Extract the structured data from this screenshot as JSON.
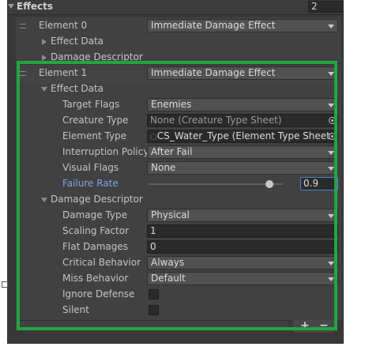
{
  "header": {
    "title": "Effects",
    "count": "2"
  },
  "element0": {
    "label": "Element 0",
    "type": "Immediate Damage Effect",
    "children": [
      "Effect Data",
      "Damage Descriptor"
    ]
  },
  "element1": {
    "label": "Element 1",
    "type": "Immediate Damage Effect",
    "effect_data": {
      "label": "Effect Data",
      "target_flags": {
        "label": "Target Flags",
        "value": "Enemies"
      },
      "creature_type": {
        "label": "Creature Type",
        "value": "None (Creature Type Sheet)"
      },
      "element_type": {
        "label": "Element Type",
        "value": "CS_Water_Type (Element Type Sheet"
      },
      "interruption_policy": {
        "label": "Interruption Policy",
        "value": "After Fail"
      },
      "visual_flags": {
        "label": "Visual Flags",
        "value": "None"
      },
      "failure_rate": {
        "label": "Failure Rate",
        "value": "0.9",
        "fraction": 0.9
      }
    },
    "damage_descriptor": {
      "label": "Damage Descriptor",
      "damage_type": {
        "label": "Damage Type",
        "value": "Physical"
      },
      "scaling_factor": {
        "label": "Scaling Factor",
        "value": "1"
      },
      "flat_damages": {
        "label": "Flat Damages",
        "value": "0"
      },
      "critical_behavior": {
        "label": "Critical Behavior",
        "value": "Always"
      },
      "miss_behavior": {
        "label": "Miss Behavior",
        "value": "Default"
      },
      "ignore_defense": {
        "label": "Ignore Defense",
        "checked": false
      },
      "silent": {
        "label": "Silent",
        "checked": false
      }
    }
  },
  "footer": {
    "add": "+",
    "remove": "−"
  },
  "colors": {
    "highlight_border": "#23a542",
    "label_focus": "#7ba4e6",
    "panel_bg": "#383838"
  },
  "icons": [
    "foldout-arrow-icon",
    "drag-handle-icon",
    "object-picker-icon",
    "scriptable-object-icon"
  ]
}
